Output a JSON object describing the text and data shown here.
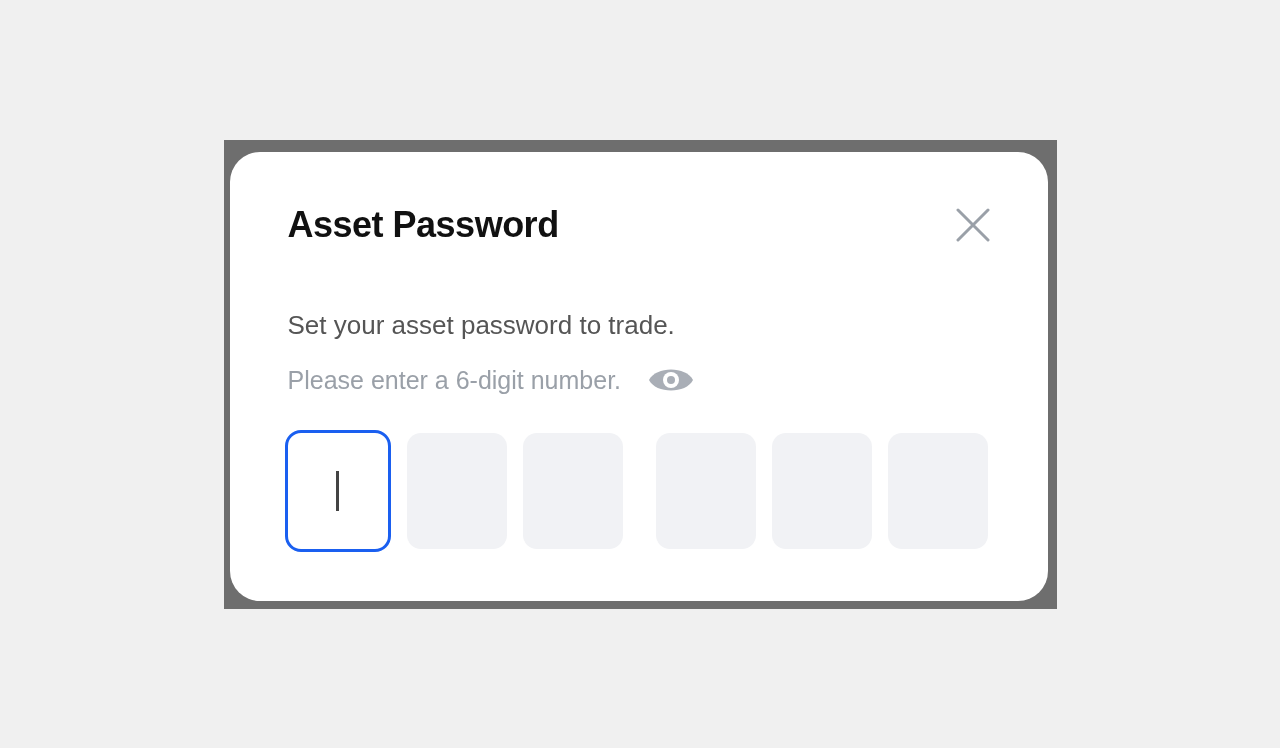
{
  "dialog": {
    "title": "Asset Password",
    "description": "Set your asset password to trade.",
    "hint": "Please enter a 6-digit number.",
    "digits": [
      {
        "selected": true
      },
      {
        "selected": false
      },
      {
        "selected": false
      },
      {
        "selected": false
      },
      {
        "selected": false
      },
      {
        "selected": false
      }
    ]
  }
}
